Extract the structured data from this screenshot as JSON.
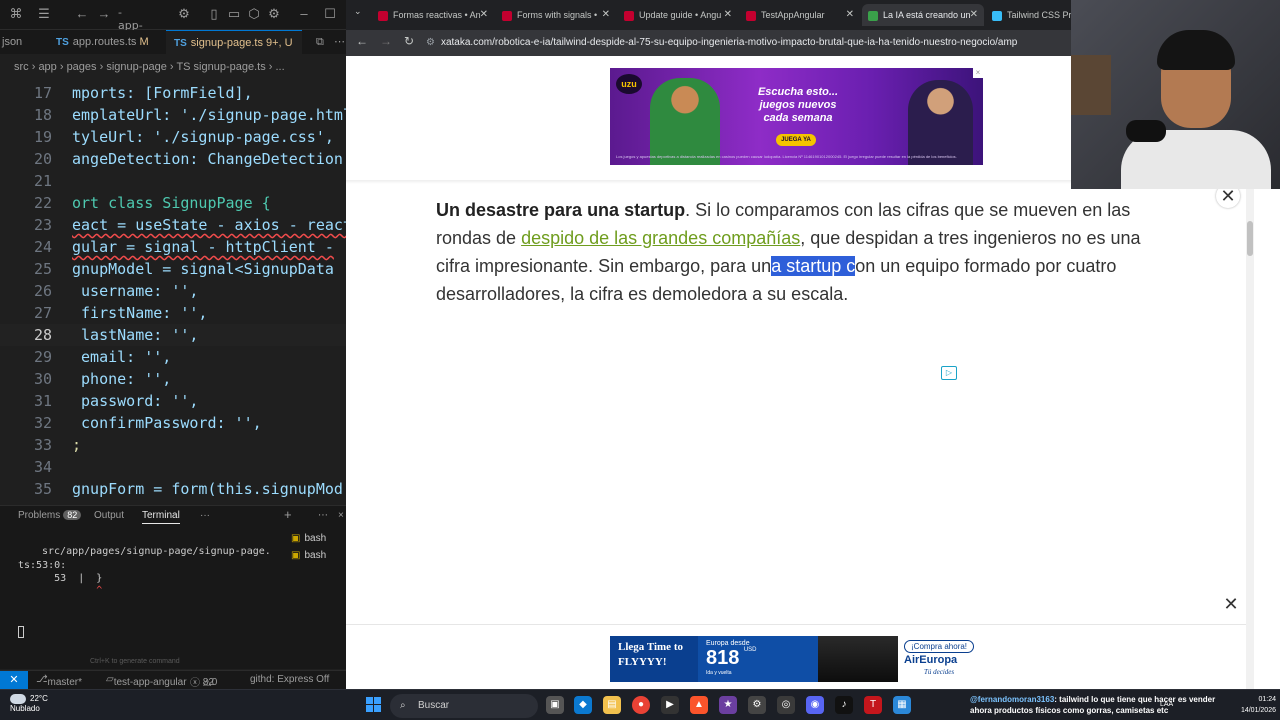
{
  "vscode": {
    "search_label": "-app-",
    "tabs": [
      {
        "label": "json"
      },
      {
        "label": "app.routes.ts",
        "modified": "M"
      },
      {
        "label": "signup-page.ts",
        "modified": "9+, U"
      }
    ],
    "tab_prefix": "TS",
    "breadcrumb": "src › app › pages › signup-page › TS signup-page.ts › ...",
    "lines": [
      {
        "n": "17",
        "html": "mports: [FormField],"
      },
      {
        "n": "18",
        "html": "emplateUrl: './signup-page.html"
      },
      {
        "n": "19",
        "html": "tyleUrl: './signup-page.css',"
      },
      {
        "n": "20",
        "html": "angeDetection: ChangeDetection"
      },
      {
        "n": "21",
        "html": ""
      },
      {
        "n": "22",
        "html": "ort class SignupPage {"
      },
      {
        "n": "23",
        "html": "eact = useState - axios - react"
      },
      {
        "n": "24",
        "html": "gular = signal - httpClient -"
      },
      {
        "n": "25",
        "html": "gnupModel = signal<SignupData"
      },
      {
        "n": "26",
        "html": " username: '',"
      },
      {
        "n": "27",
        "html": " firstName: '',"
      },
      {
        "n": "28",
        "html": " lastName: '',"
      },
      {
        "n": "29",
        "html": " email: '',"
      },
      {
        "n": "30",
        "html": " phone: '',"
      },
      {
        "n": "31",
        "html": " password: '',"
      },
      {
        "n": "32",
        "html": " confirmPassword: '',"
      },
      {
        "n": "33",
        "html": ";"
      },
      {
        "n": "34",
        "html": ""
      },
      {
        "n": "35",
        "html": "gnupForm = form(this.signupMod"
      }
    ],
    "panel": {
      "problems_label": "Problems",
      "problems_count": "82",
      "output_label": "Output",
      "terminal_label": "Terminal",
      "more": "···",
      "term_lines": [
        "src/app/pages/signup-page/signup-page.",
        "ts:53:0:",
        "      53  |  }",
        "             ^"
      ],
      "bash_items": [
        "bash",
        "bash"
      ],
      "hint": "Ctrl+K to generate command"
    },
    "status": {
      "branch": "master*",
      "project": "test-app-angular",
      "errors": "82",
      "warnings": "0",
      "extension": "githd: Express Off"
    }
  },
  "browser": {
    "tabs": [
      {
        "label": "Formas reactivas • An",
        "color": "#c3002f"
      },
      {
        "label": "Forms with signals • ",
        "color": "#c3002f"
      },
      {
        "label": "Update guide • Angu",
        "color": "#c3002f"
      },
      {
        "label": "TestAppAngular",
        "color": "#c3002f"
      },
      {
        "label": "La IA está creando un",
        "color": "#3aa14a",
        "active": true
      },
      {
        "label": "Tailwind CSS Pricin",
        "color": "#38bdf8"
      }
    ],
    "url": "xataka.com/robotica-e-ia/tailwind-despide-al-75-su-equipo-ingenieria-motivo-impacto-brutal-que-ia-ha-tenido-nuestro-negocio/amp",
    "ad_top": {
      "logo": "uzu",
      "headline": "Escucha esto... juegos nuevos cada semana",
      "cta": "JUEGA YA",
      "fine_print": "Los juegos y apuestas deportivas a distancia realizadas en casinos pueden causar ludopatía. Licencia Nº 11461901012000245. El juego irregular puede resultar en la pérdida de los beneficios."
    },
    "article": {
      "bold": "Un desastre para una startup",
      "part1": ". Si lo comparamos con las cifras que se mueven en las rondas de ",
      "link": "despido de las grandes compañías",
      "part2": ", que despidan a tres ingenieros no es una cifra impresionante. Sin embargo, para un",
      "selected": "a startup c",
      "part3": "on un equipo formado por cuatro desarrolladores, la cifra es demoledora a su escala."
    },
    "ad_bottom": {
      "left": "Llega Time to FLYYYY!",
      "from": "Europa desde",
      "price": "818",
      "currency": "USD",
      "trip": "Ida y vuelta",
      "button": "¡Compra ahora!",
      "brand": "AirEuropa",
      "slogan": "Tú decides"
    },
    "close_glyph": "✕"
  },
  "taskbar": {
    "temp": "22°C",
    "weather": "Nublado",
    "search": "Buscar",
    "chat_user": "@fernandomoran3163",
    "chat_text": ": tailwind lo que tiene que hacer es vender ahora productos físicos como gorras, camisetas etc",
    "lang": "LAA",
    "time": "01:24",
    "date": "14/01/2026"
  }
}
